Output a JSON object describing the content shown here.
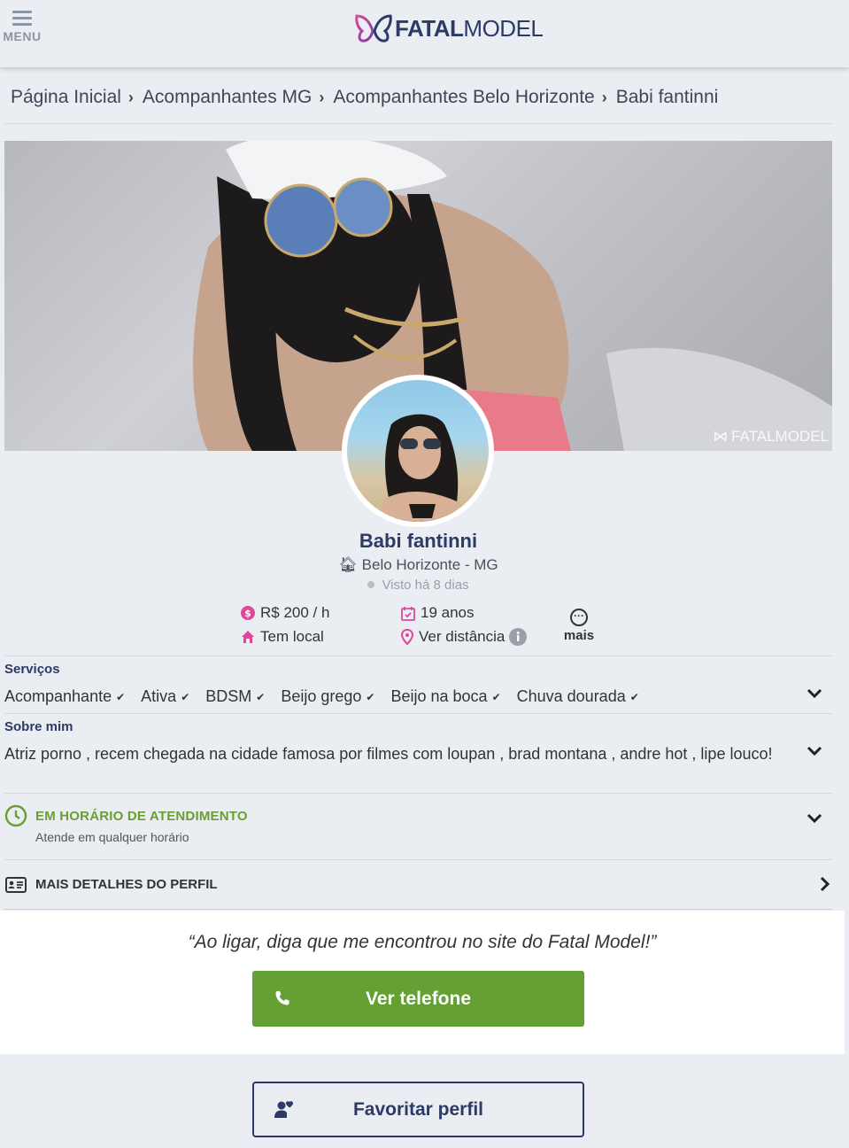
{
  "header": {
    "menu_label": "MENU",
    "logo_bold": "FATAL",
    "logo_light": "MODEL"
  },
  "breadcrumb": {
    "items": [
      "Página Inicial",
      "Acompanhantes MG",
      "Acompanhantes Belo Horizonte",
      "Babi fantinni"
    ]
  },
  "cover": {
    "watermark": "FATALMODEL"
  },
  "profile": {
    "name": "Babi fantinni",
    "city": "Belo Horizonte - MG",
    "last_seen": "Visto há 8 dias"
  },
  "stats": {
    "price": "R$ 200 / h",
    "age": "19 anos",
    "place": "Tem local",
    "distance": "Ver distância",
    "more": "mais"
  },
  "services": {
    "title": "Serviços",
    "items": [
      "Acompanhante",
      "Ativa",
      "BDSM",
      "Beijo grego",
      "Beijo na boca",
      "Chuva dourada"
    ]
  },
  "about": {
    "title": "Sobre mim",
    "text": "Atriz porno , recem chegada na cidade famosa por filmes com loupan , brad montana , andre hot , lipe louco!"
  },
  "hours": {
    "title": "EM HORÁRIO DE ATENDIMENTO",
    "subtitle": "Atende em qualquer horário"
  },
  "details": {
    "title": "MAIS DETALHES DO PERFIL"
  },
  "call": {
    "quote": "“Ao ligar, diga que me encontrou no site do Fatal Model!”",
    "phone_label": "Ver telefone",
    "favorite_label": "Favoritar perfil"
  },
  "colors": {
    "brand_navy": "#2d3a66",
    "accent_pink": "#e0479a",
    "green": "#64a034",
    "background": "#eaeef2"
  }
}
